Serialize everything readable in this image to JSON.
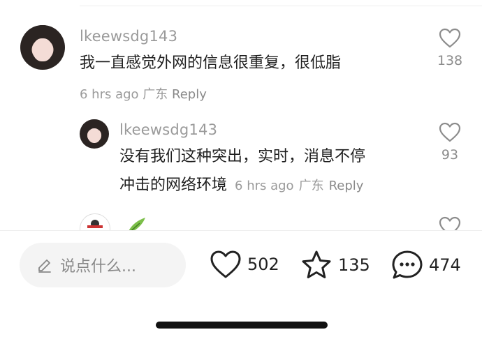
{
  "comments": [
    {
      "username": "lkeewsdg143",
      "text": "我一直感觉外网的信息很重复，很低脂",
      "time": "6 hrs ago",
      "location": "广东",
      "reply": "Reply",
      "likes": "138"
    },
    {
      "username": "lkeewsdg143",
      "text_line1": "没有我们这种突出，实时，消息不停",
      "text_line2": "冲击的网络环境",
      "time": "6 hrs ago",
      "location": "广东",
      "reply": "Reply",
      "likes": "93"
    }
  ],
  "bottom_bar": {
    "input_placeholder": "说点什么...",
    "likes": "502",
    "favorites": "135",
    "comments": "474"
  }
}
